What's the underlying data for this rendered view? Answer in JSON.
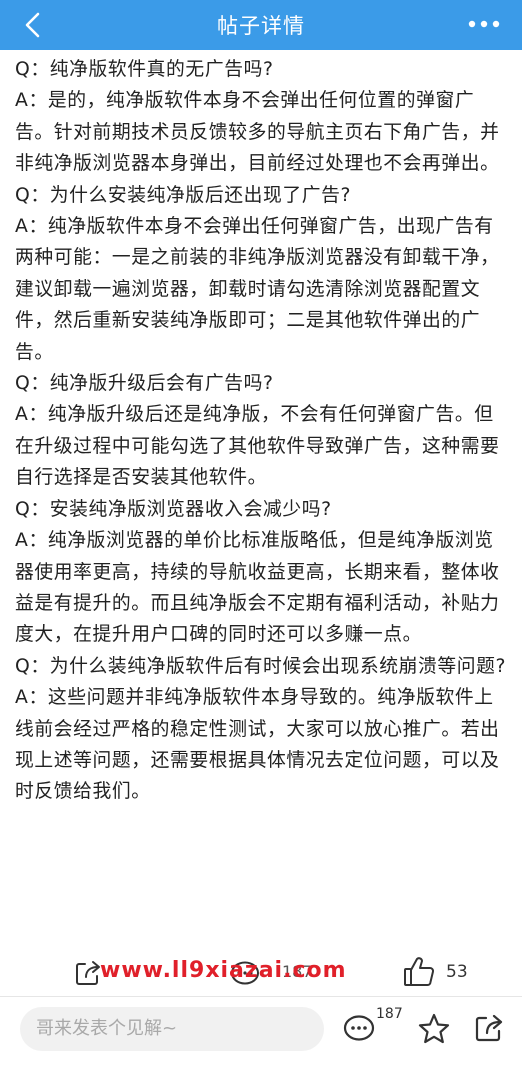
{
  "header": {
    "title": "帖子详情",
    "back_icon": "chevron-left-icon",
    "more_icon": "more-horizontal-icon",
    "bg_color": "#3b9be8"
  },
  "faq": [
    {
      "q": "Q：纯净版软件真的无广告吗?",
      "a": "A：是的，纯净版软件本身不会弹出任何位置的弹窗广告。针对前期技术员反馈较多的导航主页右下角广告，并非纯净版浏览器本身弹出，目前经过处理也不会再弹出。"
    },
    {
      "q": "Q：为什么安装纯净版后还出现了广告?",
      "a": "A：纯净版软件本身不会弹出任何弹窗广告，出现广告有两种可能：一是之前装的非纯净版浏览器没有卸载干净，建议卸载一遍浏览器，卸载时请勾选清除浏览器配置文件，然后重新安装纯净版即可；二是其他软件弹出的广告。"
    },
    {
      "q": "Q：纯净版升级后会有广告吗?",
      "a": "A：纯净版升级后还是纯净版，不会有任何弹窗广告。但在升级过程中可能勾选了其他软件导致弹广告，这种需要自行选择是否安装其他软件。"
    },
    {
      "q": "Q：安装纯净版浏览器收入会减少吗?",
      "a": "A：纯净版浏览器的单价比标准版略低，但是纯净版浏览器使用率更高，持续的导航收益更高，长期来看，整体收益是有提升的。而且纯净版会不定期有福利活动，补贴力度大，在提升用户口碑的同时还可以多赚一点。"
    },
    {
      "q": "Q：为什么装纯净版软件后有时候会出现系统崩溃等问题?",
      "a": "A：这些问题并非纯净版软件本身导致的。纯净版软件上线前会经过严格的稳定性测试，大家可以放心推广。若出现上述等问题，还需要根据具体情况去定位问题，可以及时反馈给我们。"
    }
  ],
  "watermark": "www.ll9xiazai.com",
  "actions": {
    "share_icon": "share-icon",
    "comment_icon": "comment-icon",
    "comment_count": "187",
    "like_icon": "thumbs-up-icon",
    "like_count": "53"
  },
  "bottom_bar": {
    "placeholder": "哥来发表个见解~",
    "comment_icon": "comment-icon",
    "comment_count": "187",
    "star_icon": "star-icon",
    "share_icon": "share-icon"
  }
}
